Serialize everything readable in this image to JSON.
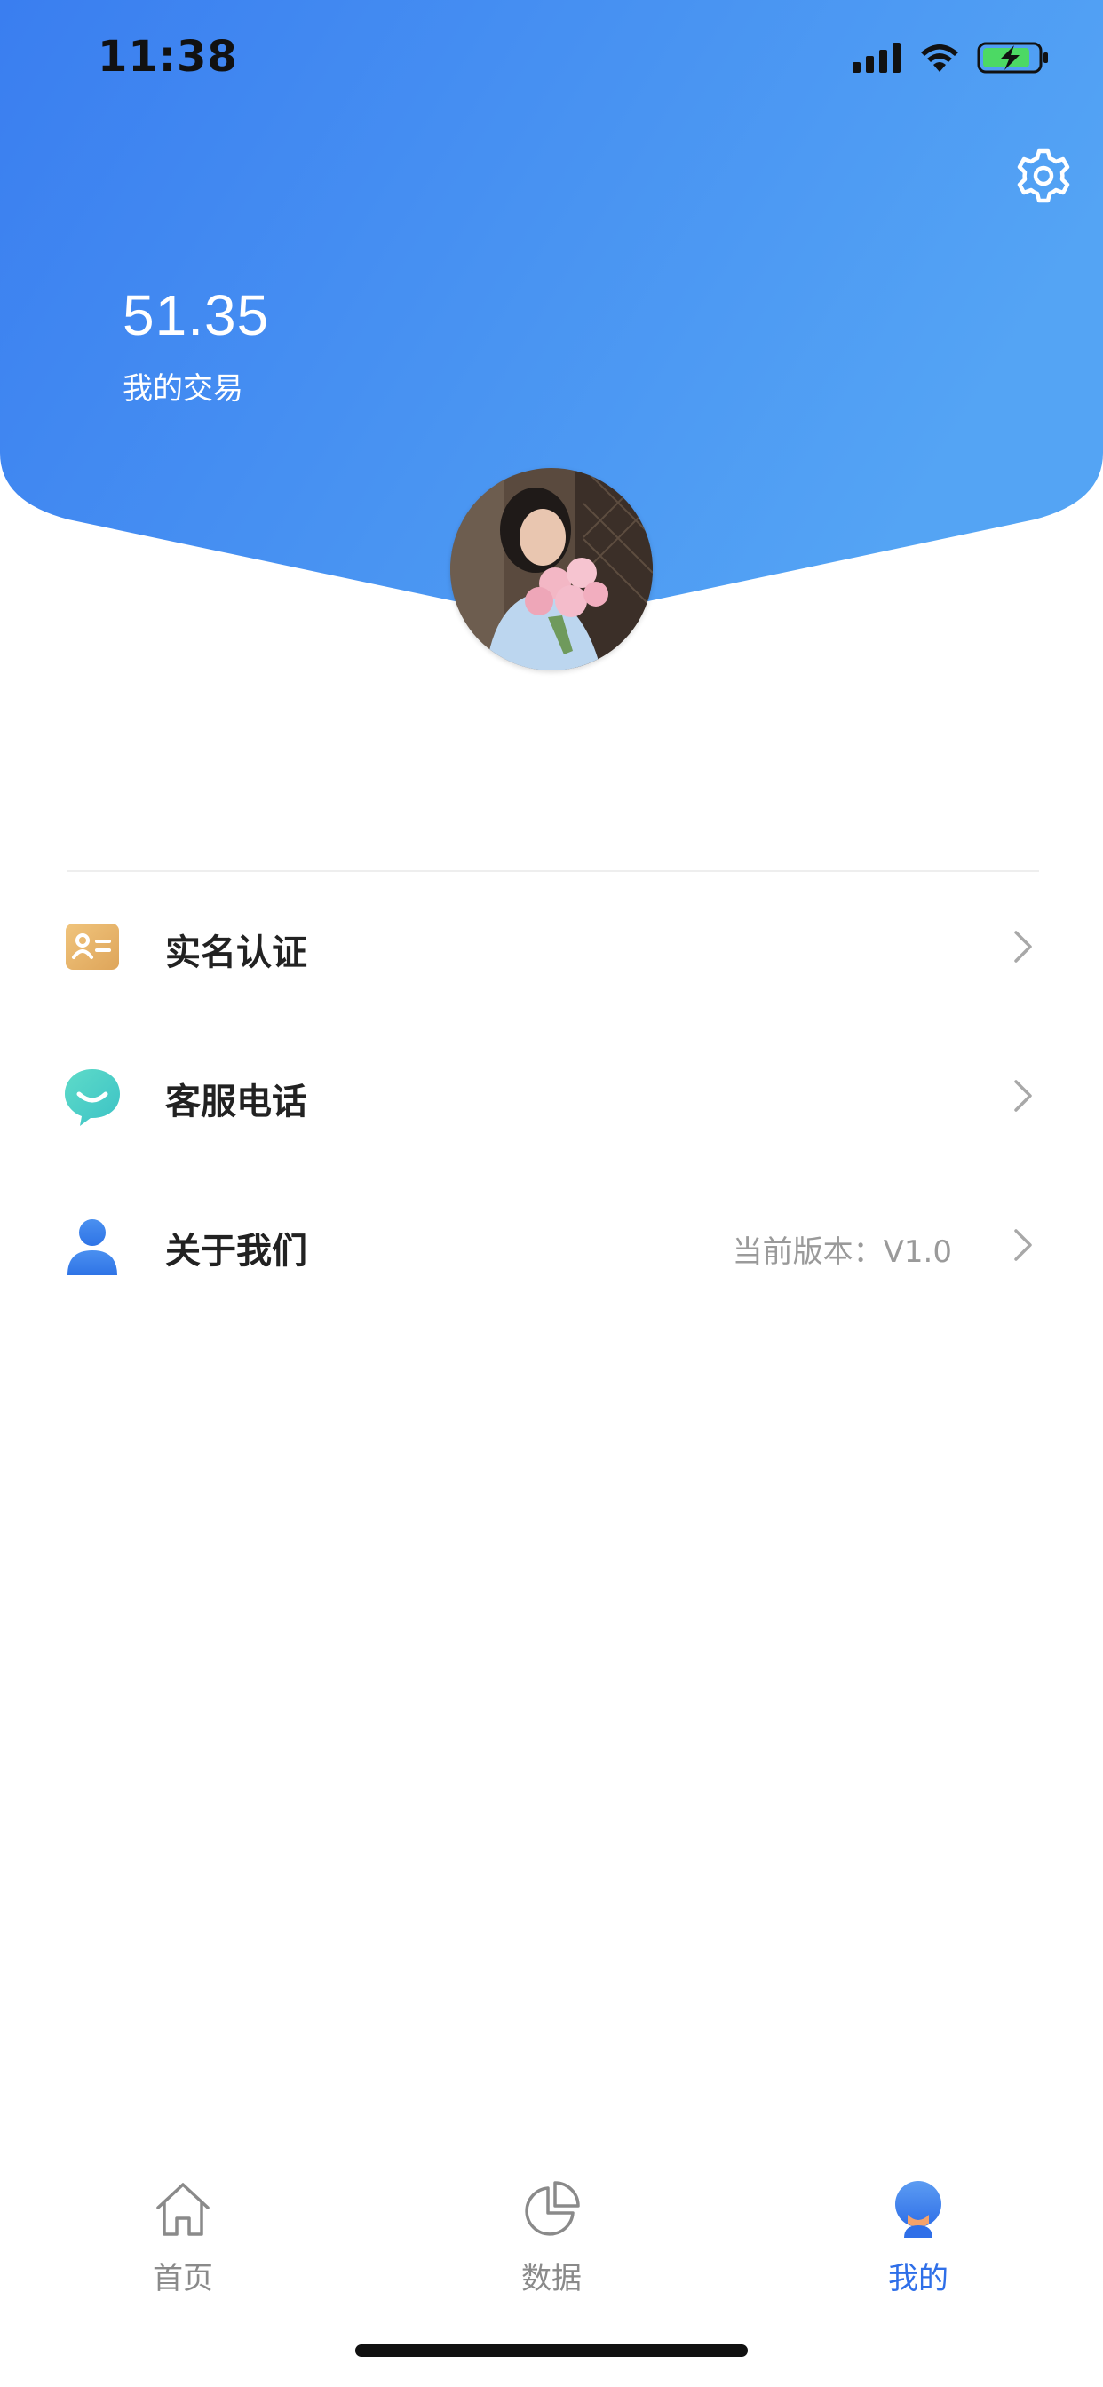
{
  "status_bar": {
    "time": "11:38"
  },
  "header": {
    "balance_value": "51.35",
    "balance_label": "我的交易",
    "gradient_start": "#3a7ef0",
    "gradient_end": "#54a4f4"
  },
  "menu": {
    "items": [
      {
        "label": "实名认证",
        "value": "",
        "icon": "id-card-icon",
        "icon_color": "#e9b86a"
      },
      {
        "label": "客服电话",
        "value": "",
        "icon": "chat-bubble-icon",
        "icon_color": "#4fd3c4"
      },
      {
        "label": "关于我们",
        "value": "当前版本：V1.0",
        "icon": "user-icon",
        "icon_color": "#3f86ec"
      }
    ]
  },
  "tab_bar": {
    "tabs": [
      {
        "label": "首页",
        "icon": "home-icon",
        "active": false
      },
      {
        "label": "数据",
        "icon": "pie-chart-icon",
        "active": false
      },
      {
        "label": "我的",
        "icon": "profile-icon",
        "active": true
      }
    ],
    "active_color": "#2f6fe8",
    "inactive_color": "#8a8a8a"
  }
}
